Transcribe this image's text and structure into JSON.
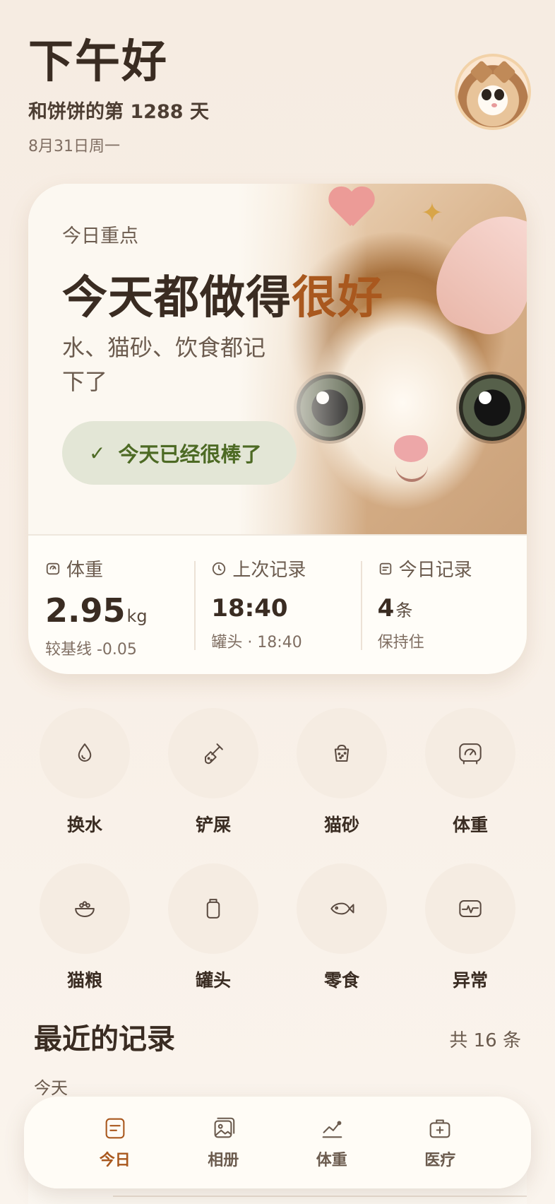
{
  "header": {
    "greeting": "下午好",
    "subtitle": "和饼饼的第 1288 天",
    "date": "8月31日周一"
  },
  "hero": {
    "label": "今日重点",
    "title_main": "今天都做得",
    "title_accent": "很好",
    "description": "水、猫砂、饮食都记下了",
    "pill_label": "今天已经很棒了",
    "colors": {
      "accent": "#a9581e",
      "pill_text": "#4d6a24",
      "pill_bg": "#e3e6d6"
    }
  },
  "stats": [
    {
      "icon": "scale-icon",
      "label": "体重",
      "value": "2.95",
      "unit": "kg",
      "note": "较基线 -0.05"
    },
    {
      "icon": "clock-icon",
      "label": "上次记录",
      "value": "18:40",
      "unit": "",
      "note": "罐头 · 18:40"
    },
    {
      "icon": "note-icon",
      "label": "今日记录",
      "value": "4",
      "unit": "条",
      "note": "保持住"
    }
  ],
  "actions": [
    {
      "icon": "water-drop-icon",
      "label": "换水"
    },
    {
      "icon": "scoop-icon",
      "label": "铲屎"
    },
    {
      "icon": "litter-box-icon",
      "label": "猫砂"
    },
    {
      "icon": "scale-icon",
      "label": "体重"
    },
    {
      "icon": "food-bowl-icon",
      "label": "猫粮"
    },
    {
      "icon": "can-icon",
      "label": "罐头"
    },
    {
      "icon": "fish-icon",
      "label": "零食"
    },
    {
      "icon": "heartbeat-icon",
      "label": "异常"
    }
  ],
  "recent": {
    "title": "最近的记录",
    "count": "共 16 条",
    "group_label": "今天"
  },
  "nav": {
    "active": "today",
    "items": [
      {
        "icon": "note-icon",
        "label": "今日"
      },
      {
        "icon": "album-icon",
        "label": "相册"
      },
      {
        "icon": "chart-icon",
        "label": "体重"
      },
      {
        "icon": "medical-kit-icon",
        "label": "医疗"
      }
    ]
  }
}
